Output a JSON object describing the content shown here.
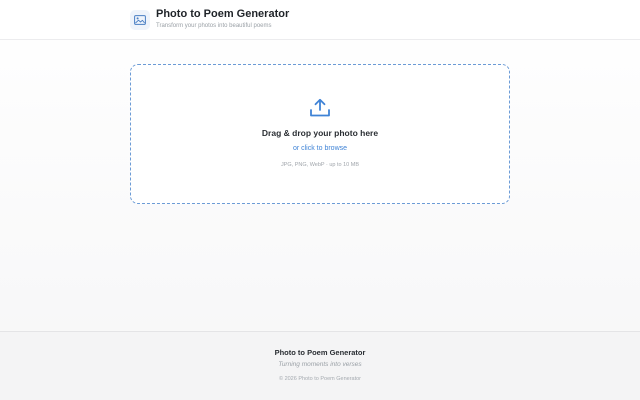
{
  "header": {
    "title": "Photo to Poem Generator",
    "subtitle": "Transform your photos into beautiful poems",
    "logo_icon": "image-icon"
  },
  "dropzone": {
    "icon": "upload-icon",
    "title": "Drag & drop your photo here",
    "browse_link": "or click to browse",
    "hint": "JPG, PNG, WebP · up to 10 MB"
  },
  "footer": {
    "title": "Photo to Poem Generator",
    "tagline": "Turning moments into verses",
    "copyright": "© 2026 Photo to Poem Generator"
  },
  "colors": {
    "accent": "#3f83d6",
    "dropzone_border": "#6b9bd6"
  }
}
